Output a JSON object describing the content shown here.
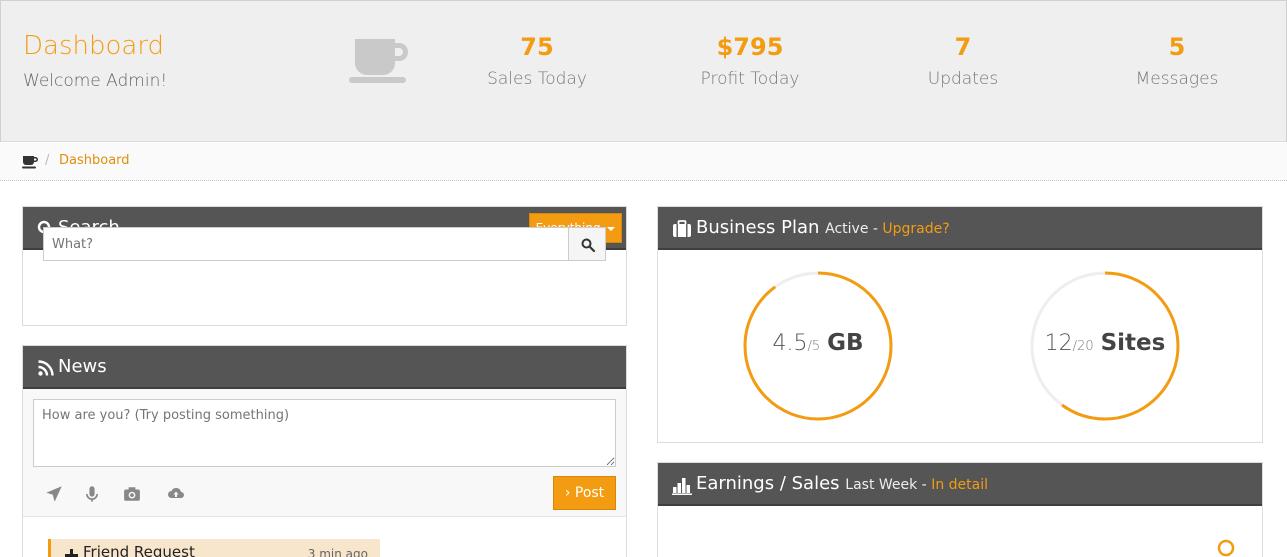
{
  "header": {
    "title": "Dashboard",
    "subtitle": "Welcome Admin!",
    "stats": [
      {
        "value": "75",
        "label": "Sales Today"
      },
      {
        "value": "$795",
        "label": "Profit Today"
      },
      {
        "value": "7",
        "label": "Updates"
      },
      {
        "value": "5",
        "label": "Messages"
      }
    ]
  },
  "breadcrumb": {
    "separator": "/",
    "current": "Dashboard"
  },
  "search": {
    "title": "Search",
    "scope_label": "Everything",
    "placeholder": "What?"
  },
  "news": {
    "title": "News",
    "placeholder": "How are you? (Try posting something)",
    "post_label": "› Post",
    "feed": [
      {
        "title": "Friend Request",
        "time": "3 min ago"
      }
    ]
  },
  "business": {
    "title": "Business Plan",
    "status": "Active",
    "dash": " - ",
    "upgrade": "Upgrade?",
    "storage": {
      "used": "4.5",
      "total": "/5",
      "unit": "GB",
      "fraction": 0.9
    },
    "sites": {
      "used": "12",
      "total": "/20",
      "unit": "Sites",
      "fraction": 0.6
    }
  },
  "earnings": {
    "title": "Earnings / Sales",
    "period": "Last Week",
    "dash": " - ",
    "detail": "In detail"
  },
  "colors": {
    "accent": "#f39c12",
    "panel_header": "#555555",
    "header_bg": "#efefef"
  }
}
